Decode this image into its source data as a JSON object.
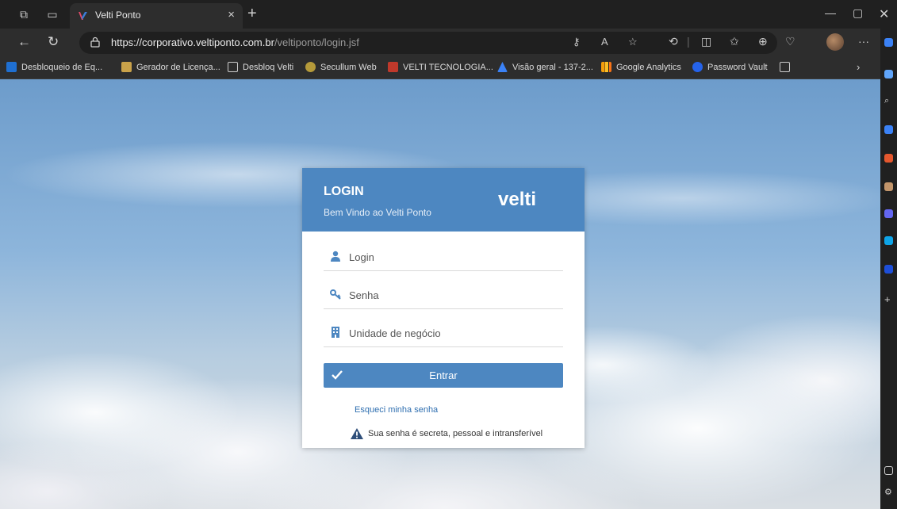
{
  "browser": {
    "tab_title": "Velti Ponto",
    "url_host": "https://corporativo.veltiponto.com.br",
    "url_path": "/veltiponto/login.jsf"
  },
  "bookmarks": [
    {
      "label": "Desbloqueio de Eq...",
      "color": "#1f6fd1"
    },
    {
      "label": "Gerador de Licença...",
      "color": "#c9a24a"
    },
    {
      "label": "Desbloq Velti",
      "color": "#cccccc"
    },
    {
      "label": "Secullum Web",
      "color": "#b59a3a"
    },
    {
      "label": "VELTI TECNOLOGIA...",
      "color": "#c0392b"
    },
    {
      "label": "Visão geral - 137-2...",
      "color": "#3b82f6"
    },
    {
      "label": "Google Analytics",
      "color": "#f59e0b"
    },
    {
      "label": "Password Vault",
      "color": "#2563eb"
    }
  ],
  "login": {
    "title": "LOGIN",
    "subtitle": "Bem Vindo ao Velti Ponto",
    "brand": "velti",
    "login_placeholder": "Login",
    "password_placeholder": "Senha",
    "unit_placeholder": "Unidade de negócio",
    "submit_label": "Entrar",
    "forgot_label": "Esqueci minha senha",
    "notice": "Sua senha é secreta, pessoal e intransferível"
  },
  "colors": {
    "header": "#4d87c1",
    "button": "#4d87c1",
    "link": "#2f6fb0"
  }
}
